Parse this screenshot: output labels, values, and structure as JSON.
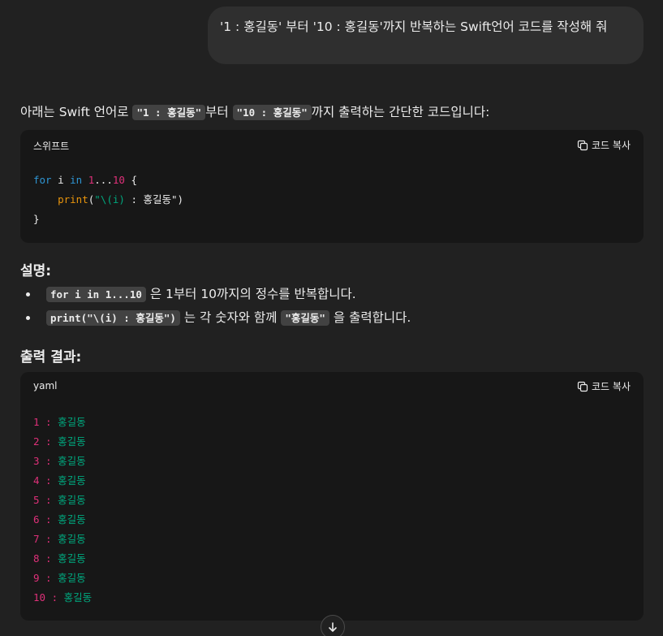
{
  "user_message": "'1 : 홍길동' 부터 '10 : 홍길동'까지 반복하는 Swift언어 코드를 작성해 줘",
  "intro": {
    "before": "아래는 Swift 언어로 ",
    "code1": "\"1 : 홍길동\"",
    "mid": "부터 ",
    "code2": "\"10 : 홍길동\"",
    "after": "까지 출력하는 간단한 코드입니다:"
  },
  "code_block_1": {
    "language": "스위프트",
    "copy_label": "코드 복사",
    "lines": {
      "l1_kw_for": "for",
      "l1_var": " i ",
      "l1_kw_in": "in",
      "l1_range_start": "1",
      "l1_range_op": "...",
      "l1_range_end": "10",
      "l1_brace": " {",
      "l2_indent": "    ",
      "l2_fn": "print",
      "l2_paren_open": "(",
      "l2_str_open": "\"",
      "l2_interp": "\\(i)",
      "l2_str_rest": " : 홍길동\"",
      "l2_paren_close": ")",
      "l3_brace": "}"
    }
  },
  "explanation": {
    "heading": "설명:",
    "items": [
      {
        "code": "for i in 1...10",
        "text": " 은 1부터 10까지의 정수를 반복합니다."
      },
      {
        "code": "print(\"\\(i) : 홍길동\")",
        "text": " 는 각 숫자와 함께 ",
        "code2": "\"홍길동\"",
        "text2": " 을 출력합니다."
      }
    ]
  },
  "output": {
    "heading": "출력 결과:",
    "language": "yaml",
    "copy_label": "코드 복사",
    "rows": [
      {
        "key": "1",
        "value": "홍길동"
      },
      {
        "key": "2",
        "value": "홍길동"
      },
      {
        "key": "3",
        "value": "홍길동"
      },
      {
        "key": "4",
        "value": "홍길동"
      },
      {
        "key": "5",
        "value": "홍길동"
      },
      {
        "key": "6",
        "value": "홍길동"
      },
      {
        "key": "7",
        "value": "홍길동"
      },
      {
        "key": "8",
        "value": "홍길동"
      },
      {
        "key": "9",
        "value": "홍길동"
      },
      {
        "key": "10",
        "value": "홍길동"
      }
    ],
    "separator": " : "
  },
  "icons": {
    "copy": "copy-icon",
    "scroll_down": "arrow-down-icon"
  },
  "colors": {
    "background": "#212121",
    "user_bubble": "#2f2f2f",
    "code_bg": "#171717",
    "keyword": "#2e95d3",
    "number": "#df3079",
    "function": "#e9950c",
    "string": "#00a67d"
  }
}
